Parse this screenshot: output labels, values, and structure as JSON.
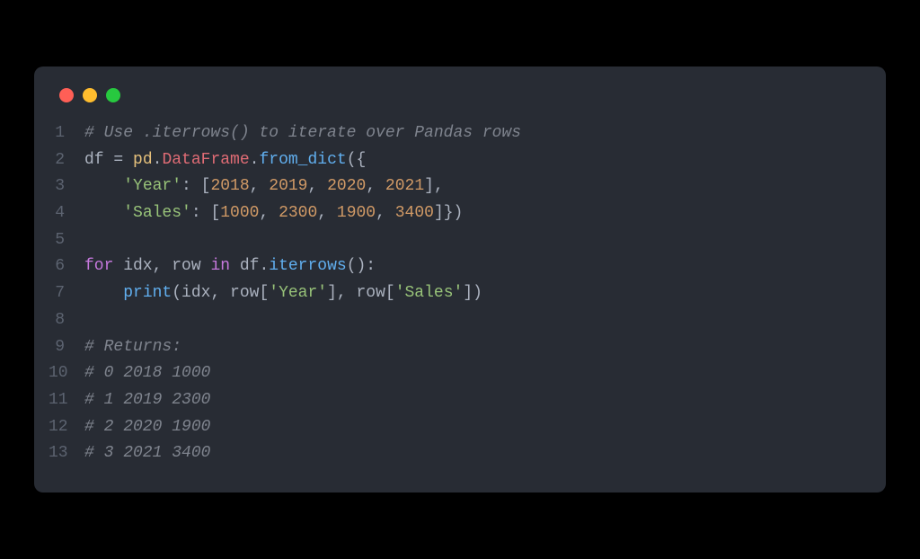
{
  "colors": {
    "background_page": "#000000",
    "background_window": "#282c34",
    "close": "#ff5f56",
    "minimize": "#ffbd2e",
    "maximize": "#27c93f",
    "gutter": "#5c6370",
    "default_text": "#abb2bf",
    "comment": "#7f848e",
    "number": "#d19a66",
    "string": "#98c379",
    "keyword": "#c678dd",
    "function": "#61afef",
    "object": "#e5c07b",
    "property": "#e06c75"
  },
  "lines": [
    {
      "num": "1",
      "tokens": [
        {
          "cls": "t-comment",
          "text": "# Use .iterrows() to iterate over Pandas rows"
        }
      ]
    },
    {
      "num": "2",
      "tokens": [
        {
          "cls": "t-var",
          "text": "df "
        },
        {
          "cls": "t-op",
          "text": "= "
        },
        {
          "cls": "t-obj",
          "text": "pd"
        },
        {
          "cls": "t-op",
          "text": "."
        },
        {
          "cls": "t-prop",
          "text": "DataFrame"
        },
        {
          "cls": "t-op",
          "text": "."
        },
        {
          "cls": "t-func",
          "text": "from_dict"
        },
        {
          "cls": "t-op",
          "text": "({"
        }
      ]
    },
    {
      "num": "3",
      "tokens": [
        {
          "cls": "t-op",
          "text": "    "
        },
        {
          "cls": "t-str",
          "text": "'Year'"
        },
        {
          "cls": "t-op",
          "text": ": ["
        },
        {
          "cls": "t-num",
          "text": "2018"
        },
        {
          "cls": "t-op",
          "text": ", "
        },
        {
          "cls": "t-num",
          "text": "2019"
        },
        {
          "cls": "t-op",
          "text": ", "
        },
        {
          "cls": "t-num",
          "text": "2020"
        },
        {
          "cls": "t-op",
          "text": ", "
        },
        {
          "cls": "t-num",
          "text": "2021"
        },
        {
          "cls": "t-op",
          "text": "],"
        }
      ]
    },
    {
      "num": "4",
      "tokens": [
        {
          "cls": "t-op",
          "text": "    "
        },
        {
          "cls": "t-str",
          "text": "'Sales'"
        },
        {
          "cls": "t-op",
          "text": ": ["
        },
        {
          "cls": "t-num",
          "text": "1000"
        },
        {
          "cls": "t-op",
          "text": ", "
        },
        {
          "cls": "t-num",
          "text": "2300"
        },
        {
          "cls": "t-op",
          "text": ", "
        },
        {
          "cls": "t-num",
          "text": "1900"
        },
        {
          "cls": "t-op",
          "text": ", "
        },
        {
          "cls": "t-num",
          "text": "3400"
        },
        {
          "cls": "t-op",
          "text": "]})"
        }
      ]
    },
    {
      "num": "5",
      "tokens": [
        {
          "cls": "t-op",
          "text": ""
        }
      ]
    },
    {
      "num": "6",
      "tokens": [
        {
          "cls": "t-kw",
          "text": "for"
        },
        {
          "cls": "t-op",
          "text": " idx, row "
        },
        {
          "cls": "t-kw",
          "text": "in"
        },
        {
          "cls": "t-op",
          "text": " df."
        },
        {
          "cls": "t-func",
          "text": "iterrows"
        },
        {
          "cls": "t-op",
          "text": "():"
        }
      ]
    },
    {
      "num": "7",
      "tokens": [
        {
          "cls": "t-op",
          "text": "    "
        },
        {
          "cls": "t-func",
          "text": "print"
        },
        {
          "cls": "t-op",
          "text": "(idx, row["
        },
        {
          "cls": "t-str",
          "text": "'Year'"
        },
        {
          "cls": "t-op",
          "text": "], row["
        },
        {
          "cls": "t-str",
          "text": "'Sales'"
        },
        {
          "cls": "t-op",
          "text": "])"
        }
      ]
    },
    {
      "num": "8",
      "tokens": [
        {
          "cls": "t-op",
          "text": ""
        }
      ]
    },
    {
      "num": "9",
      "tokens": [
        {
          "cls": "t-comment",
          "text": "# Returns:"
        }
      ]
    },
    {
      "num": "10",
      "tokens": [
        {
          "cls": "t-comment",
          "text": "# 0 2018 1000"
        }
      ]
    },
    {
      "num": "11",
      "tokens": [
        {
          "cls": "t-comment",
          "text": "# 1 2019 2300"
        }
      ]
    },
    {
      "num": "12",
      "tokens": [
        {
          "cls": "t-comment",
          "text": "# 2 2020 1900"
        }
      ]
    },
    {
      "num": "13",
      "tokens": [
        {
          "cls": "t-comment",
          "text": "# 3 2021 3400"
        }
      ]
    }
  ]
}
